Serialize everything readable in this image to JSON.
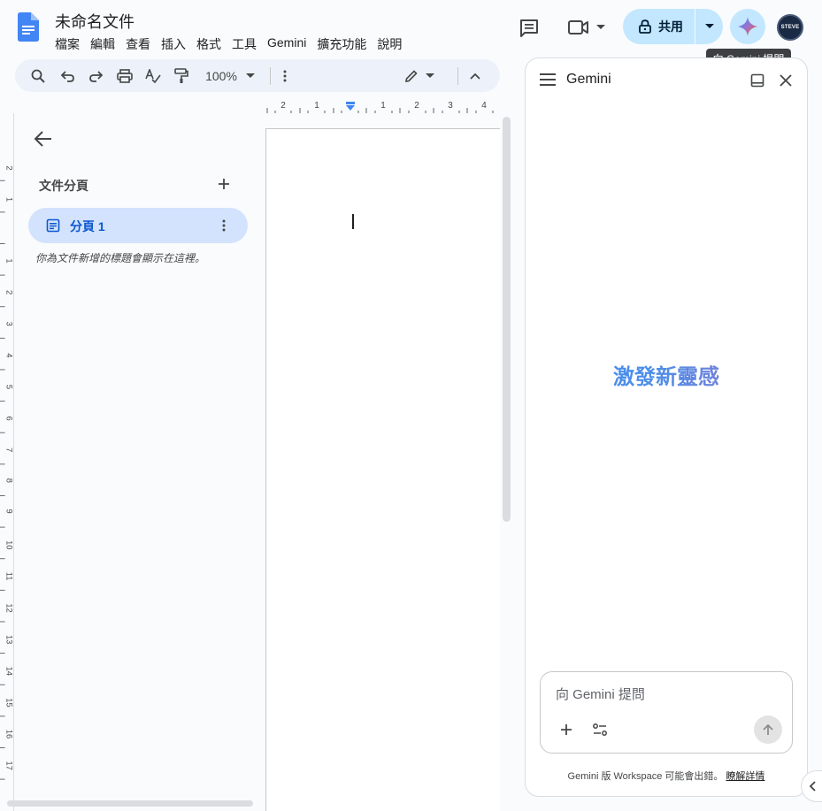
{
  "app": {
    "doc_title": "未命名文件",
    "menu": [
      "檔案",
      "編輯",
      "查看",
      "插入",
      "格式",
      "工具",
      "Gemini",
      "擴充功能",
      "說明"
    ]
  },
  "header": {
    "share_label": "共用",
    "gemini_tooltip": "向 Gemini 提問",
    "avatar_text": "STEVE"
  },
  "toolbar": {
    "zoom": "100%"
  },
  "ruler": {
    "h_labels": [
      "2",
      "1",
      "1",
      "2",
      "3",
      "4"
    ],
    "v_labels": [
      "2",
      "1",
      "1",
      "2",
      "3",
      "4",
      "5",
      "6",
      "7",
      "8",
      "9",
      "10",
      "11",
      "12",
      "13",
      "14",
      "15",
      "16",
      "17"
    ]
  },
  "outline": {
    "tabs_title": "文件分頁",
    "tab_label": "分頁 1",
    "hint": "你為文件新增的標題會顯示在這裡。"
  },
  "gemini": {
    "title": "Gemini",
    "hero": "激發新靈感",
    "input_placeholder": "向 Gemini 提問",
    "footer_text": "Gemini 版 Workspace 可能會出錯。",
    "footer_link": "瞭解詳情"
  },
  "colors": {
    "accent": "#0b57d0",
    "share_bg": "#c2e7ff",
    "active_tab_bg": "#d3e3fd",
    "toolbar_bg": "#edf2fa"
  }
}
